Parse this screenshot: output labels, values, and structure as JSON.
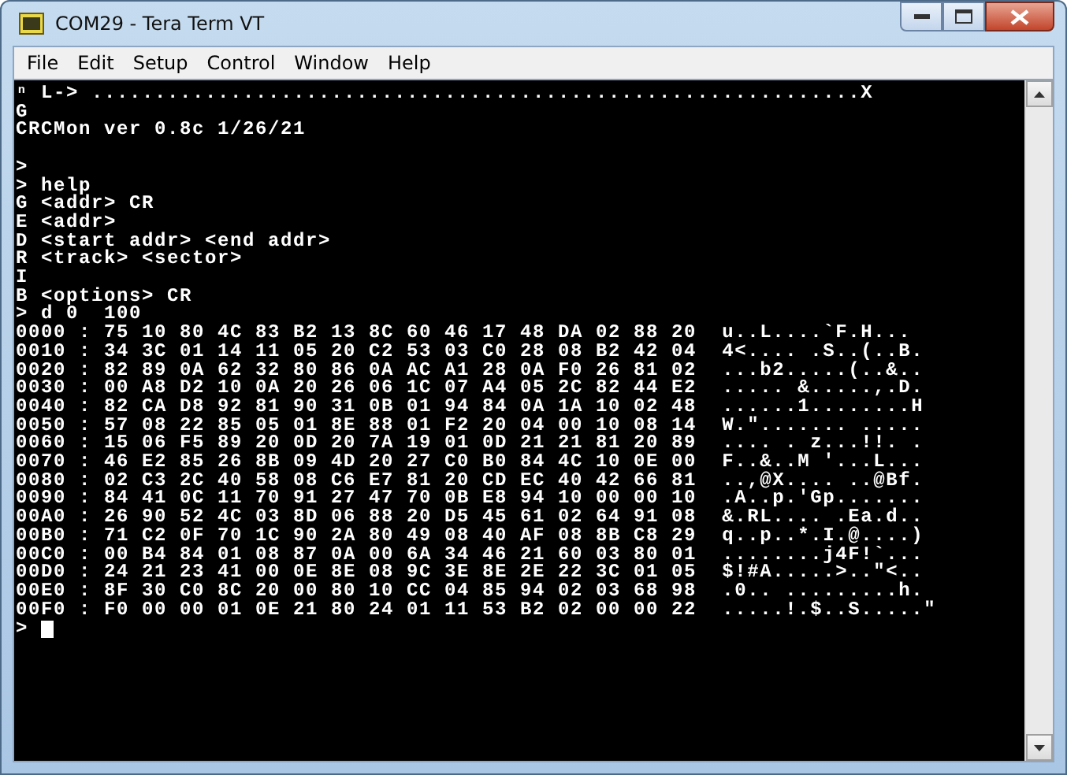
{
  "window": {
    "title": "COM29 - Tera Term VT"
  },
  "menu": [
    "File",
    "Edit",
    "Setup",
    "Control",
    "Window",
    "Help"
  ],
  "terminal": {
    "blocks": [
      [
        "ⁿ L-> .............................................................X",
        "G",
        "CRCMon ver 0.8c 1/26/21"
      ],
      [
        ">",
        "> help",
        "G <addr> CR",
        "E <addr>",
        "D <start addr> <end addr>",
        "R <track> <sector>",
        "I",
        "B <options> CR",
        "> d 0  100",
        "0000 : 75 10 80 4C 83 B2 13 8C 60 46 17 48 DA 02 88 20  u..L....`F.H...",
        "0010 : 34 3C 01 14 11 05 20 C2 53 03 C0 28 08 B2 42 04  4<.... .S..(..B.",
        "0020 : 82 89 0A 62 32 80 86 0A AC A1 28 0A F0 26 81 02  ...b2.....(..&..",
        "0030 : 00 A8 D2 10 0A 20 26 06 1C 07 A4 05 2C 82 44 E2  ..... &.....,.D.",
        "0040 : 82 CA D8 92 81 90 31 0B 01 94 84 0A 1A 10 02 48  ......1........H",
        "0050 : 57 08 22 85 05 01 8E 88 01 F2 20 04 00 10 08 14  W.\"....... .....",
        "0060 : 15 06 F5 89 20 0D 20 7A 19 01 0D 21 21 81 20 89  .... . z...!!. .",
        "0070 : 46 E2 85 26 8B 09 4D 20 27 C0 B0 84 4C 10 0E 00  F..&..M '...L...",
        "0080 : 02 C3 2C 40 58 08 C6 E7 81 20 CD EC 40 42 66 81  ..,@X.... ..@Bf.",
        "0090 : 84 41 0C 11 70 91 27 47 70 0B E8 94 10 00 00 10  .A..p.'Gp.......",
        "00A0 : 26 90 52 4C 03 8D 06 88 20 D5 45 61 02 64 91 08  &.RL.... .Ea.d..",
        "00B0 : 71 C2 0F 70 1C 90 2A 80 49 08 40 AF 08 8B C8 29  q..p..*.I.@....)",
        "00C0 : 00 B4 84 01 08 87 0A 00 6A 34 46 21 60 03 80 01  ........j4F!`...",
        "00D0 : 24 21 23 41 00 0E 8E 08 9C 3E 8E 2E 22 3C 01 05  $!#A.....>..\"<..",
        "00E0 : 8F 30 C0 8C 20 00 80 10 CC 04 85 94 02 03 68 98  .0.. .........h.",
        "00F0 : F0 00 00 01 0E 21 80 24 01 11 53 B2 02 00 00 22  .....!.$..S.....\"",
        ">"
      ]
    ],
    "cursor": true
  }
}
